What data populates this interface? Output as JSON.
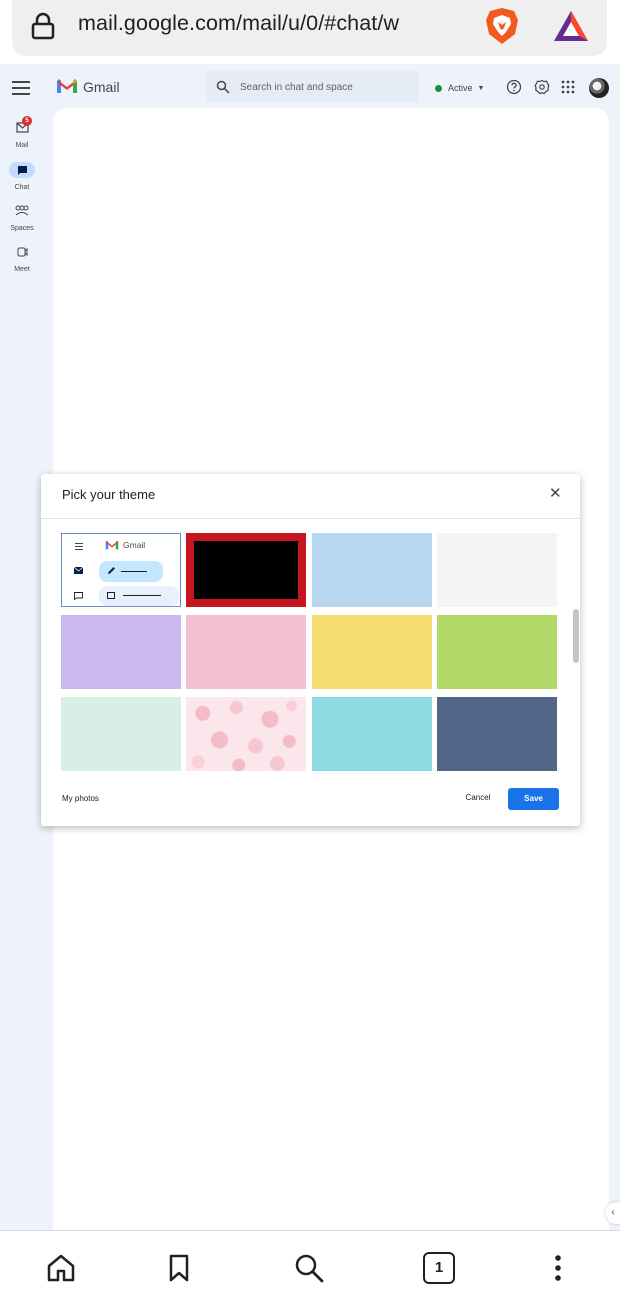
{
  "browser": {
    "url": "mail.google.com/mail/u/0/#chat/w",
    "tab_count": "1"
  },
  "rail": {
    "items": [
      {
        "label": "Mail",
        "badge": "5"
      },
      {
        "label": "Chat"
      },
      {
        "label": "Spaces"
      },
      {
        "label": "Meet"
      }
    ]
  },
  "header": {
    "app_name": "Gmail",
    "search_placeholder": "Search in chat and space",
    "status": "Active"
  },
  "theme_dialog": {
    "title": "Pick your theme",
    "preview_app_name": "Gmail",
    "themes": [
      {
        "name": "default",
        "color": "#ffffff"
      },
      {
        "name": "black",
        "color": "#000000",
        "selected": true
      },
      {
        "name": "light-blue",
        "color": "#b7d7f1"
      },
      {
        "name": "light-gray",
        "color": "#f4f4f4"
      },
      {
        "name": "lavender",
        "color": "#cab8ee"
      },
      {
        "name": "pink",
        "color": "#f2bfd1"
      },
      {
        "name": "yellow",
        "color": "#f7dc6f"
      },
      {
        "name": "green",
        "color": "#b2d968"
      },
      {
        "name": "mint",
        "color": "#d9efe5"
      },
      {
        "name": "floral",
        "color": "#fbe6ec"
      },
      {
        "name": "cyan",
        "color": "#8edce3"
      },
      {
        "name": "slate",
        "color": "#536688"
      }
    ],
    "my_photos": "My photos",
    "cancel": "Cancel",
    "save": "Save"
  }
}
